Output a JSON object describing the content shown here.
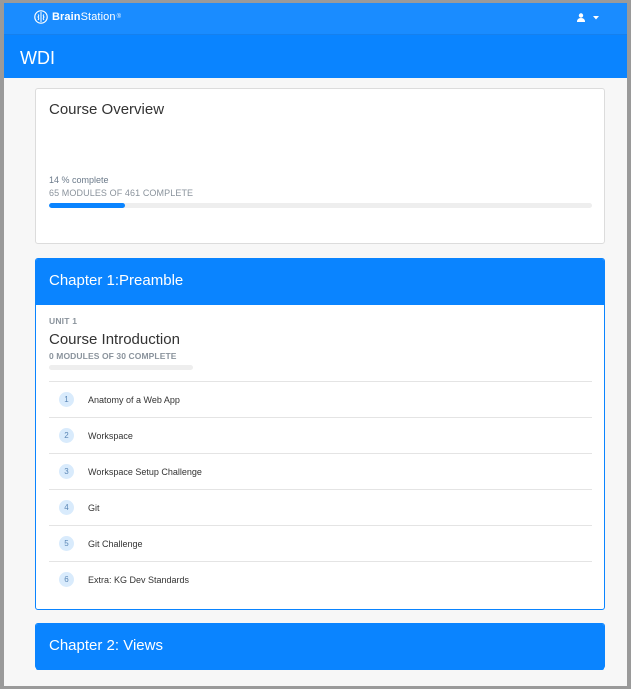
{
  "header": {
    "brand_bold": "Brain",
    "brand_rest": "Station",
    "brand_tm": "®",
    "logo_icon": "brain-icon",
    "user_icon": "user-icon",
    "menu_icon": "caret-down-icon",
    "accent": "#0a84ff"
  },
  "page": {
    "title": "WDI"
  },
  "overview": {
    "title": "Course Overview",
    "percent_text": "14 % complete",
    "modules_text": "65 MODULES OF 461 COMPLETE",
    "progress": 0.14
  },
  "chapters": [
    {
      "title": "Chapter 1:Preamble",
      "unit": {
        "label": "UNIT 1",
        "title": "Course Introduction",
        "modules_text": "0 MODULES OF 30 COMPLETE",
        "progress": 0,
        "lessons": [
          {
            "number": "1",
            "name": "Anatomy of a Web App"
          },
          {
            "number": "2",
            "name": "Workspace"
          },
          {
            "number": "3",
            "name": "Workspace Setup Challenge"
          },
          {
            "number": "4",
            "name": "Git"
          },
          {
            "number": "5",
            "name": "Git Challenge"
          },
          {
            "number": "6",
            "name": "Extra: KG Dev Standards"
          }
        ]
      }
    },
    {
      "title": "Chapter 2: Views"
    }
  ]
}
